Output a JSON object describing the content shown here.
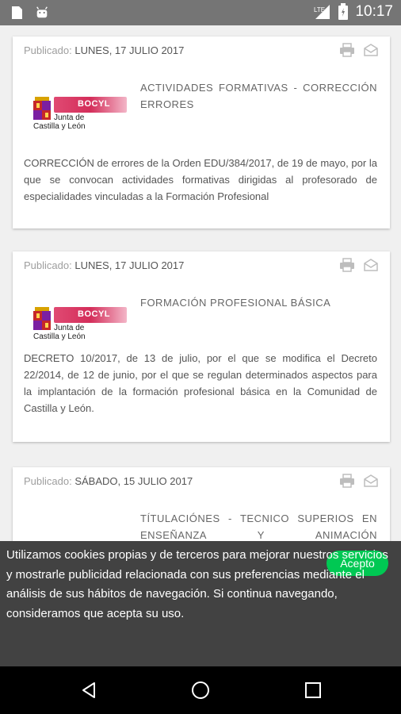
{
  "status_bar": {
    "time": "10:17",
    "network": "LTE",
    "icons": [
      "sd-card-icon",
      "android-icon",
      "lte-signal-icon",
      "battery-icon"
    ]
  },
  "articles": [
    {
      "published_label": "Publicado:",
      "date": "LUNES, 17 JULIO 2017",
      "logo": "junta-castilla-y-leon-logo",
      "logo_text": {
        "band": "BOCYL",
        "line1": "Junta de",
        "line2": "Castilla y León"
      },
      "title": "ACTIVIDADES FORMATIVAS - CORRECCIÓN ERRORES",
      "body": "CORRECCIÓN de errores de la Orden EDU/384/2017, de 19 de mayo, por la que se convocan actividades formativas dirigidas al profesorado de especialidades vinculadas a la Formación Profesional"
    },
    {
      "published_label": "Publicado:",
      "date": "LUNES, 17 JULIO 2017",
      "logo": "junta-castilla-y-leon-logo",
      "logo_text": {
        "band": "BOCYL",
        "line1": "Junta de",
        "line2": "Castilla y León"
      },
      "title": "FORMACIÓN PROFESIONAL BÁSICA",
      "body": "DECRETO 10/2017, de 13 de julio, por el que se modifica el Decreto 22/2014, de 12 de junio, por el que se regulan determinados aspectos para la implantación de la formación profesional básica en la Comunidad de Castilla y León."
    },
    {
      "published_label": "Publicado:",
      "date": "SÁBADO, 15 JULIO 2017",
      "logo": "boe-logo",
      "title": "TÍTULACIÓNES - TECNICO SUPERIOS EN ENSEÑANZA Y ANIMACIÓN SOCIODEPORTIVA",
      "body": ""
    }
  ],
  "cookie_banner": {
    "text": "Utilizamos cookies propias y de terceros para mejorar nuestros servicios y mostrarle publicidad relacionada con sus preferencias mediante el análisis de sus hábitos de navegación. Si continua navegando, consideramos que acepta su uso.",
    "accept_label": "Acepto"
  },
  "colors": {
    "status_bar": "#757575",
    "accept_button": "#00c853",
    "cookie_background": "#424242",
    "bocyl_band": "#d42e5a",
    "boe_blue": "#1f3c7a"
  }
}
